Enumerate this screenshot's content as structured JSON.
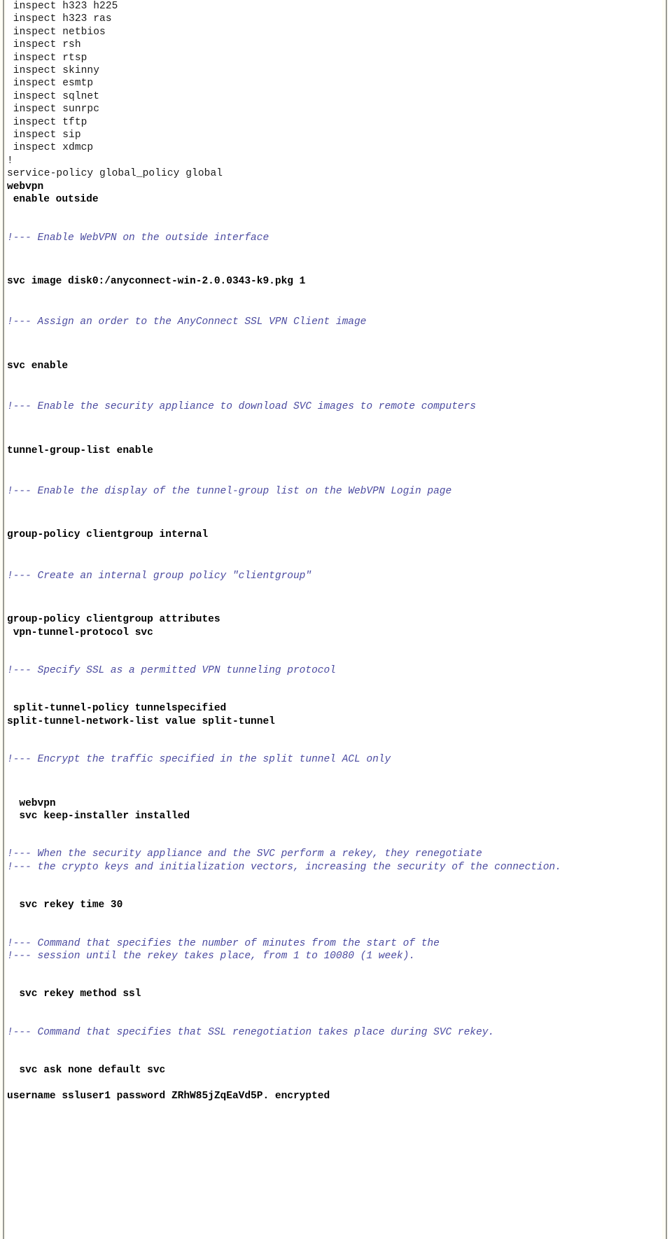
{
  "document": {
    "kind": "cisco-asa-cli-configuration-excerpt",
    "colors": {
      "background": "#ffffff",
      "command_text": "#000000",
      "plain_text": "#1a1a1a",
      "remark_text": "#4b4ba0",
      "border_rule": "#9a9a94",
      "border_cream": "#fffef5"
    },
    "inspect_block": [
      " inspect h323 h225",
      " inspect h323 ras",
      " inspect netbios",
      " inspect rsh",
      " inspect rtsp",
      " inspect skinny",
      " inspect esmtp",
      " inspect sqlnet",
      " inspect sunrpc",
      " inspect tftp",
      " inspect sip",
      " inspect xdmcp",
      "!",
      "service-policy global_policy global"
    ],
    "sections": [
      {
        "id": "webvpn-enable",
        "commands": [
          "webvpn",
          " enable outside"
        ],
        "remarks": [
          "!--- Enable WebVPN on the outside interface"
        ]
      },
      {
        "id": "svc-image",
        "commands": [
          "svc image disk0:/anyconnect-win-2.0.0343-k9.pkg 1"
        ],
        "remarks": [
          "!--- Assign an order to the AnyConnect SSL VPN Client image"
        ]
      },
      {
        "id": "svc-enable",
        "commands": [
          "svc enable"
        ],
        "remarks": [
          "!--- Enable the security appliance to download SVC images to remote computers"
        ]
      },
      {
        "id": "tunnel-group-list",
        "commands": [
          "tunnel-group-list enable"
        ],
        "remarks": [
          "!--- Enable the display of the tunnel-group list on the WebVPN Login page"
        ]
      },
      {
        "id": "group-policy-internal",
        "commands": [
          "group-policy clientgroup internal"
        ],
        "remarks": [
          "!--- Create an internal group policy \"clientgroup\""
        ]
      },
      {
        "id": "group-policy-attributes",
        "commands": [
          "group-policy clientgroup attributes",
          " vpn-tunnel-protocol svc"
        ],
        "remarks": [
          "!--- Specify SSL as a permitted VPN tunneling protocol"
        ]
      },
      {
        "id": "split-tunnel",
        "commands": [
          " split-tunnel-policy tunnelspecified",
          "split-tunnel-network-list value split-tunnel"
        ],
        "remarks": [
          "!--- Encrypt the traffic specified in the split tunnel ACL only"
        ]
      },
      {
        "id": "svc-keep-installer",
        "commands": [
          "  webvpn",
          "  svc keep-installer installed"
        ],
        "remarks": [
          "!--- When the security appliance and the SVC perform a rekey, they renegotiate",
          "!--- the crypto keys and initialization vectors, increasing the security of the connection."
        ]
      },
      {
        "id": "svc-rekey-time",
        "commands": [
          "  svc rekey time 30"
        ],
        "remarks": [
          "!--- Command that specifies the number of minutes from the start of the",
          "!--- session until the rekey takes place, from 1 to 10080 (1 week)."
        ]
      },
      {
        "id": "svc-rekey-method",
        "commands": [
          "  svc rekey method ssl"
        ],
        "remarks": [
          "!--- Command that specifies that SSL renegotiation takes place during SVC rekey."
        ]
      },
      {
        "id": "svc-ask-username",
        "commands": [
          "  svc ask none default svc",
          "username ssluser1 password ZRhW85jZqEaVd5P. encrypted"
        ],
        "remarks": []
      }
    ]
  }
}
